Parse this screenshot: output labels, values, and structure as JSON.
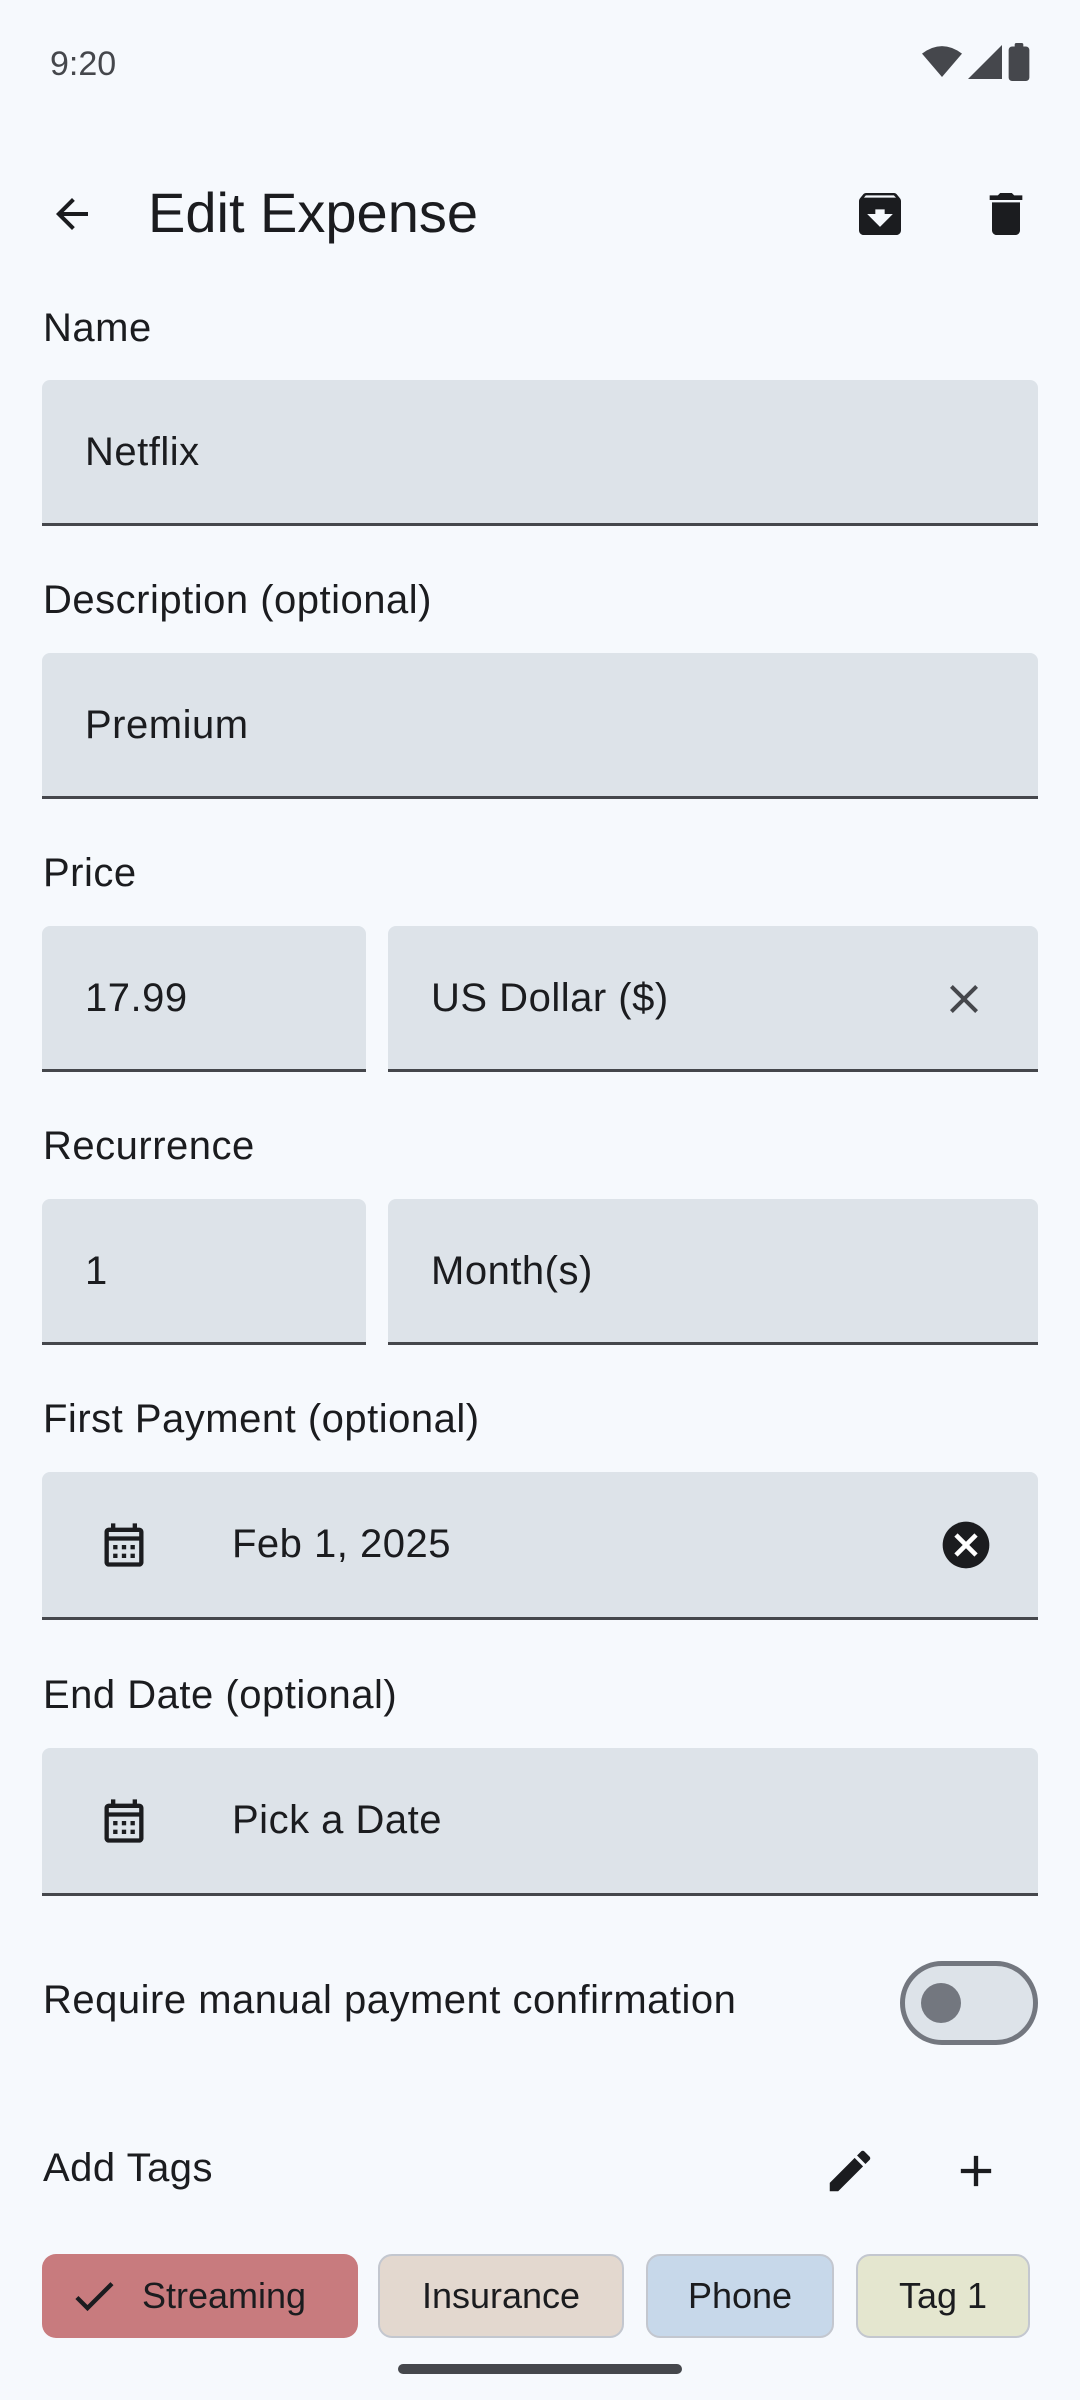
{
  "status_bar": {
    "time": "9:20"
  },
  "app_bar": {
    "title": "Edit Expense"
  },
  "form": {
    "name": {
      "label": "Name",
      "value": "Netflix"
    },
    "description": {
      "label": "Description (optional)",
      "value": "Premium"
    },
    "price": {
      "label": "Price",
      "amount": "17.99",
      "currency": "US Dollar ($)"
    },
    "recurrence": {
      "label": "Recurrence",
      "count": "1",
      "unit": "Month(s)"
    },
    "first_payment": {
      "label": "First Payment (optional)",
      "value": "Feb 1, 2025"
    },
    "end_date": {
      "label": "End Date (optional)",
      "placeholder": "Pick a Date"
    },
    "manual_confirmation": {
      "label": "Require manual payment confirmation",
      "enabled": false
    }
  },
  "tags": {
    "label": "Add Tags",
    "items": [
      {
        "label": "Streaming",
        "selected": true,
        "color": "#c87b7e"
      },
      {
        "label": "Insurance",
        "selected": false,
        "color": "#e3d8cf"
      },
      {
        "label": "Phone",
        "selected": false,
        "color": "#c7d8ea"
      },
      {
        "label": "Tag 1",
        "selected": false,
        "color": "#e4e6cf"
      }
    ]
  },
  "icons": {
    "back": "arrow-left-icon",
    "archive": "archive-icon",
    "delete": "trash-icon",
    "clear": "close-icon",
    "calendar": "calendar-icon",
    "edit": "pencil-icon",
    "add": "plus-icon",
    "check": "check-icon"
  },
  "colors": {
    "background": "#f6f9fd",
    "field_fill": "#dde3e9",
    "text": "#1b1c1f"
  }
}
